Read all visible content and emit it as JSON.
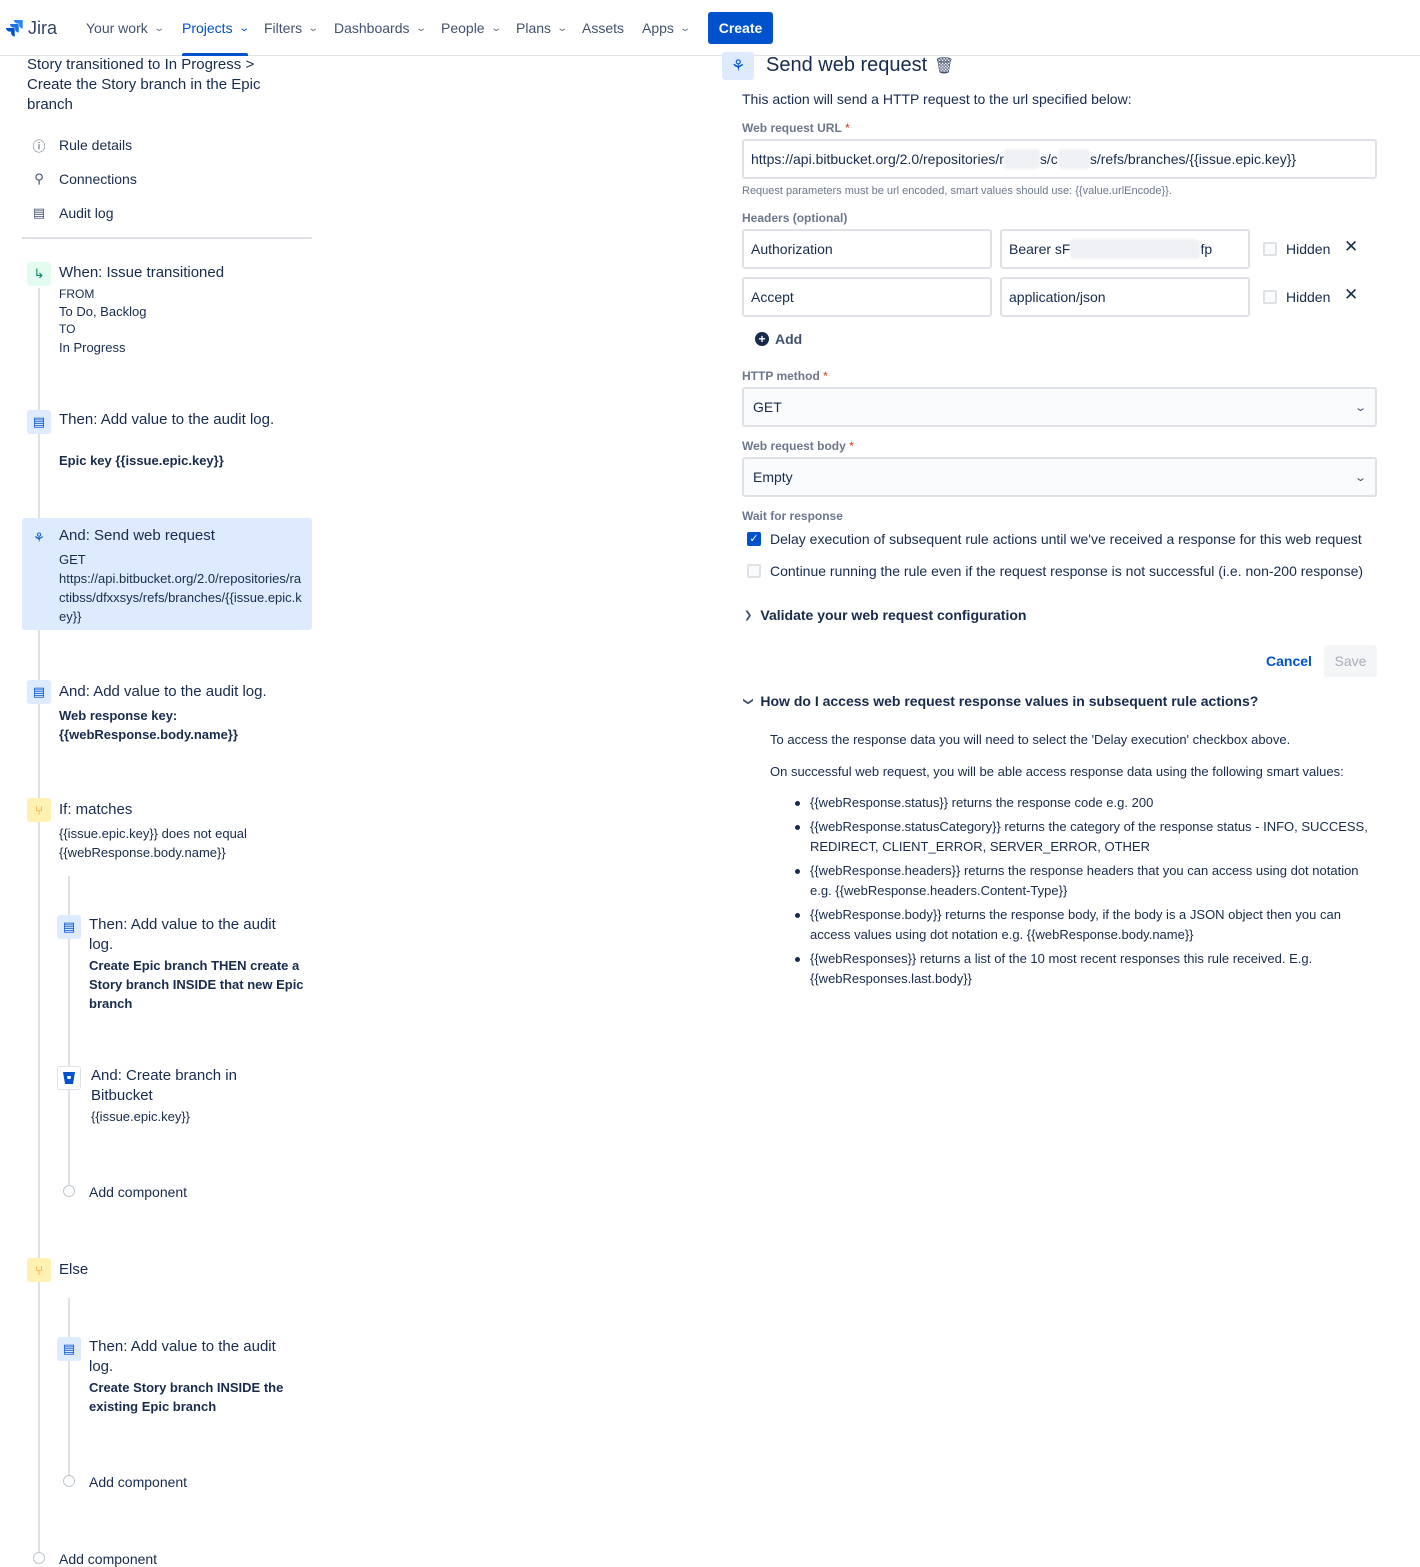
{
  "nav": {
    "logo": "Jira",
    "items": [
      "Your work",
      "Projects",
      "Filters",
      "Dashboards",
      "People",
      "Plans",
      "Assets",
      "Apps"
    ],
    "create": "Create"
  },
  "rule": {
    "title": "Story transitioned to In Progress > Create the Story branch in the Epic branch",
    "links": [
      "Rule details",
      "Connections",
      "Audit log"
    ]
  },
  "flow": {
    "trigger": {
      "title": "When: Issue transitioned",
      "from_label": "FROM",
      "from": "To Do, Backlog",
      "to_label": "TO",
      "to": "In Progress"
    },
    "log1": {
      "title": "Then: Add value to the audit log.",
      "detail": "Epic key {{issue.epic.key}}"
    },
    "web": {
      "title": "And: Send web request",
      "method": "GET",
      "url": "https://api.bitbucket.org/2.0/repositories/ractibss/dfxxsys/refs/branches/{{issue.epic.key}}"
    },
    "log2": {
      "title": "And: Add value to the audit log.",
      "detail": "Web response key: {{webResponse.body.name}}"
    },
    "cond": {
      "title": "If: matches",
      "detail": "{{issue.epic.key}} does not equal {{webResponse.body.name}}"
    },
    "log3": {
      "title": "Then: Add value to the audit log.",
      "detail": "Create Epic branch THEN create a Story branch INSIDE that new Epic branch"
    },
    "branch": {
      "title": "And: Create branch in Bitbucket",
      "detail": "{{issue.epic.key}}"
    },
    "else": {
      "title": "Else"
    },
    "log4": {
      "title": "Then: Add value to the audit log.",
      "detail": "Create Story branch INSIDE the existing Epic branch"
    },
    "add_component": "Add component"
  },
  "panel": {
    "title": "Send web request",
    "description": "This action will send a HTTP request to the url specified below:",
    "url_label": "Web request URL",
    "url_part1": "https://api.bitbucket.org/2.0/repositories/r",
    "url_part2": "s/c",
    "url_part3": "s/refs/branches/{{issue.epic.key}}",
    "url_hint": "Request parameters must be url encoded, smart values should use: {{value.urlEncode}}.",
    "headers_label": "Headers (optional)",
    "headers": [
      {
        "key": "Authorization",
        "value_start": "Bearer sF",
        "value_end": "fp",
        "hidden": "Hidden"
      },
      {
        "key": "Accept",
        "value": "application/json",
        "hidden": "Hidden"
      }
    ],
    "add": "Add",
    "method_label": "HTTP method",
    "method": "GET",
    "body_label": "Web request body",
    "body": "Empty",
    "wait_label": "Wait for response",
    "delay_option": "Delay execution of subsequent rule actions until we've received a response for this web request",
    "continue_option": "Continue running the rule even if the request response is not successful (i.e. non-200 response)",
    "validate": "Validate your web request configuration",
    "cancel": "Cancel",
    "save": "Save",
    "faq_title": "How do I access web request response values in subsequent rule actions?",
    "faq_p1": "To access the response data you will need to select the 'Delay execution' checkbox above.",
    "faq_p2": "On successful web request, you will be able access response data using the following smart values:",
    "faq_items": [
      "{{webResponse.status}} returns the response code e.g. 200",
      "{{webResponse.statusCategory}} returns the category of the response status - INFO, SUCCESS, REDIRECT, CLIENT_ERROR, SERVER_ERROR, OTHER",
      "{{webResponse.headers}} returns the response headers that you can access using dot notation e.g. {{webResponse.headers.Content-Type}}",
      "{{webResponse.body}} returns the response body, if the body is a JSON object then you can access values using dot notation e.g. {{webResponse.body.name}}",
      "{{webResponses}} returns a list of the 10 most recent responses this rule received. E.g. {{webResponses.last.body}}"
    ]
  },
  "colors": {
    "primary": "#0052cc",
    "text": "#172b4d",
    "muted": "#6b778c",
    "selected_bg": "#deebff"
  }
}
